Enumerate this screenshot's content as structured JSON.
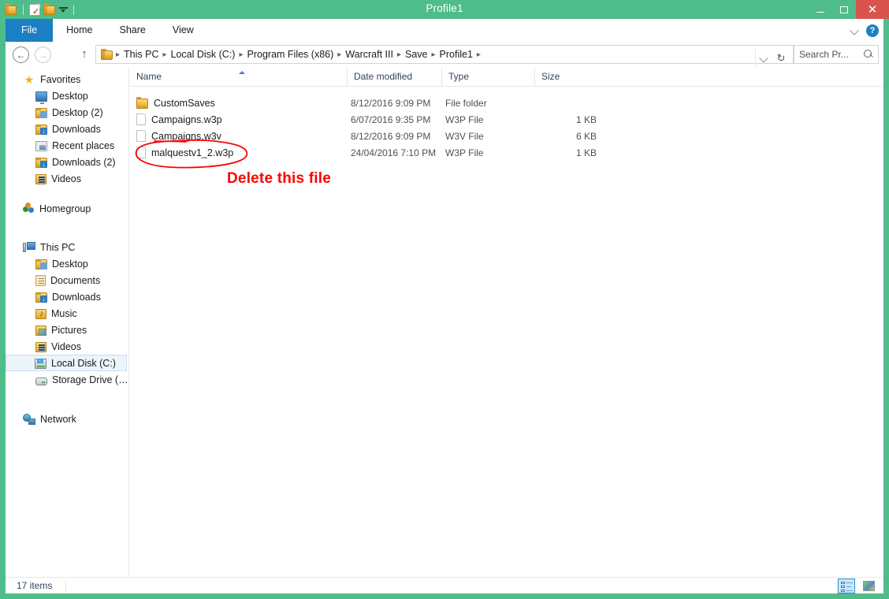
{
  "window": {
    "title": "Profile1",
    "accent_green": "#4FBC8B",
    "close_red": "#D9534F",
    "file_tab_blue": "#1B7FC4",
    "annotation_red": "#FF0000"
  },
  "quick_access": {
    "items": [
      {
        "icon": "folder-icon",
        "name": "qat-folder-icon"
      },
      {
        "icon": "properties-icon",
        "name": "qat-properties-icon"
      },
      {
        "icon": "new-folder-icon",
        "name": "qat-new-folder-icon"
      },
      {
        "icon": "chevron-down-icon",
        "name": "qat-customize-icon"
      }
    ]
  },
  "window_controls": {
    "minimize": "–",
    "maximize": "□",
    "close": "✕"
  },
  "ribbon": {
    "tabs": [
      {
        "label": "File",
        "active": true
      },
      {
        "label": "Home",
        "active": false
      },
      {
        "label": "Share",
        "active": false
      },
      {
        "label": "View",
        "active": false
      }
    ],
    "expand_icon": "chevron-down-icon",
    "help_icon": "help-icon",
    "help_glyph": "?"
  },
  "addressbar": {
    "back_glyph": "←",
    "forward_glyph": "→",
    "up_glyph": "↑",
    "refresh_glyph": "↻",
    "breadcrumb": [
      "This PC",
      "Local Disk (C:)",
      "Program Files (x86)",
      "Warcraft III",
      "Save",
      "Profile1"
    ],
    "separator": "▸"
  },
  "search": {
    "placeholder": "Search Pr...",
    "icon": "search-icon"
  },
  "sidebar": {
    "groups": [
      {
        "root": {
          "label": "Favorites",
          "icon": "star-icon"
        },
        "children": [
          {
            "label": "Desktop",
            "icon": "monitor-icon",
            "selected": false
          },
          {
            "label": "Desktop (2)",
            "icon": "desktop-folder-icon",
            "selected": false
          },
          {
            "label": "Downloads",
            "icon": "downloads-folder-icon",
            "selected": false
          },
          {
            "label": "Recent places",
            "icon": "recent-places-icon",
            "selected": false
          },
          {
            "label": "Downloads (2)",
            "icon": "downloads-folder-icon",
            "selected": false
          },
          {
            "label": "Videos",
            "icon": "videos-folder-icon",
            "selected": false
          }
        ]
      },
      {
        "root": {
          "label": "Homegroup",
          "icon": "homegroup-icon"
        },
        "children": []
      },
      {
        "root": {
          "label": "This PC",
          "icon": "this-pc-icon"
        },
        "children": [
          {
            "label": "Desktop",
            "icon": "desktop-folder-icon",
            "selected": false
          },
          {
            "label": "Documents",
            "icon": "documents-folder-icon",
            "selected": false
          },
          {
            "label": "Downloads",
            "icon": "downloads-folder-icon",
            "selected": false
          },
          {
            "label": "Music",
            "icon": "music-folder-icon",
            "selected": false
          },
          {
            "label": "Pictures",
            "icon": "pictures-folder-icon",
            "selected": false
          },
          {
            "label": "Videos",
            "icon": "videos-folder-icon",
            "selected": false
          },
          {
            "label": "Local Disk (C:)",
            "icon": "local-disk-icon",
            "selected": true
          },
          {
            "label": "Storage Drive (T:)",
            "icon": "storage-drive-icon",
            "selected": false
          }
        ]
      },
      {
        "root": {
          "label": "Network",
          "icon": "network-icon"
        },
        "children": []
      }
    ]
  },
  "filelist": {
    "columns": [
      {
        "label": "Name",
        "sorted": "asc"
      },
      {
        "label": "Date modified",
        "sorted": ""
      },
      {
        "label": "Type",
        "sorted": ""
      },
      {
        "label": "Size",
        "sorted": ""
      }
    ],
    "rows": [
      {
        "name": "CustomSaves",
        "icon": "folder-icon",
        "date_modified": "8/12/2016 9:09 PM",
        "type": "File folder",
        "size": ""
      },
      {
        "name": "Campaigns.w3p",
        "icon": "file-icon",
        "date_modified": "6/07/2016 9:35 PM",
        "type": "W3P File",
        "size": "1 KB"
      },
      {
        "name": "Campaigns.w3v",
        "icon": "file-icon",
        "date_modified": "8/12/2016 9:09 PM",
        "type": "W3V File",
        "size": "6 KB"
      },
      {
        "name": "malquestv1_2.w3p",
        "icon": "file-icon",
        "date_modified": "24/04/2016 7:10 PM",
        "type": "W3P File",
        "size": "1 KB"
      }
    ]
  },
  "annotation": {
    "text": "Delete this file",
    "color": "#FF0000",
    "circled_item": "malquestv1_2.w3p"
  },
  "statusbar": {
    "item_count": "17 items",
    "view_buttons": [
      {
        "icon": "details-view-icon",
        "selected": true
      },
      {
        "icon": "large-icons-view-icon",
        "selected": false
      }
    ]
  }
}
